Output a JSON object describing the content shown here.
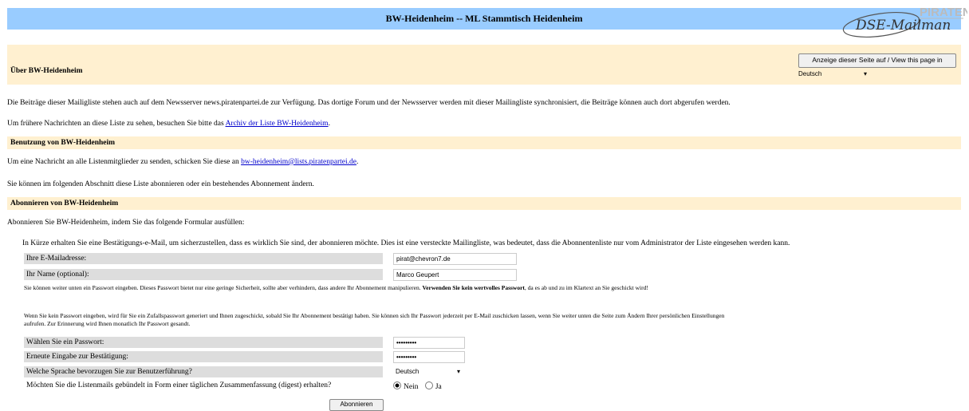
{
  "header": {
    "title": "BW-Heidenheim -- ML Stammtisch Heidenheim",
    "logo_text": "PIRATEN DSE-Mailman"
  },
  "about": {
    "heading": "Über BW-Heidenheim",
    "lang_button": "Anzeige dieser Seite auf / View this page in",
    "lang_select": "Deutsch",
    "para1": "Die Beiträge dieser Mailigliste stehen auch auf dem Newsserver news.piratenpartei.de zur Verfügung. Das dortige Forum und der Newsserver werden mit dieser Mailingliste synchronisiert, die Beiträge können auch dort abgerufen werden.",
    "para2_prefix": "Um frühere Nachrichten an diese Liste zu sehen, besuchen Sie bitte das ",
    "para2_link": "Archiv der Liste BW-Heidenheim",
    "para2_suffix": "."
  },
  "usage": {
    "heading": "Benutzung von BW-Heidenheim",
    "para1_prefix": "Um eine Nachricht an alle Listenmitglieder zu senden, schicken Sie diese an ",
    "para1_link": "bw-heidenheim@lists.piratenpartei.de",
    "para1_suffix": ".",
    "para2": "Sie können im folgenden Abschnitt diese Liste abonnieren oder ein bestehendes Abonnement ändern."
  },
  "subscribe": {
    "heading": "Abonnieren von BW-Heidenheim",
    "intro": "Abonnieren Sie BW-Heidenheim, indem Sie das folgende Formular ausfüllen:",
    "notice": "In Kürze erhalten Sie eine Bestätigungs-e-Mail, um sicherzustellen, dass es wirklich Sie sind, der abonnieren möchte. Dies ist eine versteckte Mailingliste, was bedeutet, dass die Abonnentenliste nur vom Administrator der Liste eingesehen werden kann.",
    "email_label": "Ihre E-Mailadresse:",
    "email_value": "pirat@chevron7.de",
    "name_label": "Ihr Name (optional):",
    "name_value": "Marco Geupert",
    "pw_note1": "Sie können weiter unten ein Passwort eingeben. Dieses Passwort bietet nur eine geringe Sicherheit, sollte aber verhindern, dass andere Ihr Abonnement manipulieren.",
    "pw_note1_bold": "Verwenden Sie kein wertvolles Passwort",
    "pw_note1_suffix": ", da es ab und zu im Klartext an Sie geschickt wird!",
    "pw_note2": "Wenn Sie kein Passwort eingeben, wird für Sie ein Zufallspasswort generiert und Ihnen zugeschickt, sobald Sie Ihr Abonnement bestätigt haben. Sie können sich Ihr Passwort jederzeit per E-Mail zuschicken lassen, wenn Sie weiter unten die Seite zum Ändern Ihrer persönlichen Einstellungen aufrufen. Zur Erinnerung wird Ihnen monatlich Ihr Passwort gesandt.",
    "pw_label": "Wählen Sie ein Passwort:",
    "pw_value": "•••••••••",
    "pw_confirm_label": "Erneute Eingabe zur Bestätigung:",
    "pw_confirm_value": "•••••••••",
    "lang_label": "Welche Sprache bevorzugen Sie zur Benutzerführung?",
    "lang_value": "Deutsch",
    "digest_label": "Möchten Sie die Listenmails gebündelt in Form einer täglichen Zusammenfassung (digest) erhalten?",
    "digest_no": "Nein",
    "digest_yes": "Ja",
    "submit_label": "Abonnieren"
  }
}
